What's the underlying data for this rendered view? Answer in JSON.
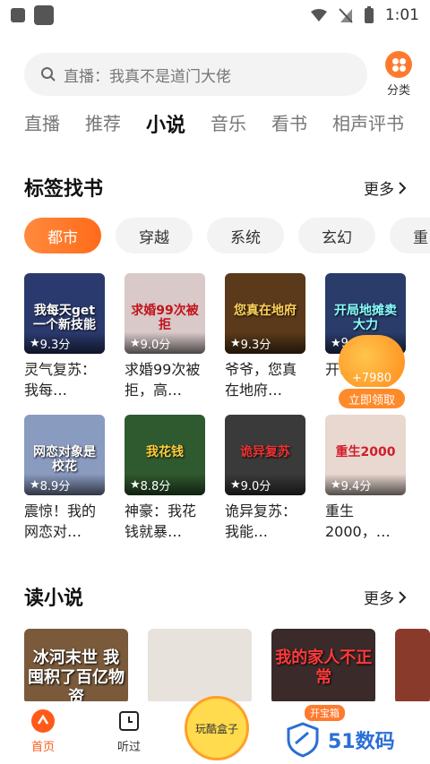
{
  "status": {
    "time": "1:01"
  },
  "search": {
    "placeholder_text": "直播：我真不是道门大佬",
    "category_label": "分类"
  },
  "tabs": [
    "直播",
    "推荐",
    "小说",
    "音乐",
    "看书",
    "相声评书"
  ],
  "section1": {
    "title": "标签找书",
    "more": "更多"
  },
  "chips": [
    "都市",
    "穿越",
    "系统",
    "玄幻",
    "重"
  ],
  "books_row1": [
    {
      "cover": "我每天get一个新技能",
      "rating": "9.3分",
      "name": "灵气复苏：我每…",
      "color": "#2b3a6e"
    },
    {
      "cover": "求婚99次被拒",
      "rating": "9.0分",
      "name": "求婚99次被拒，高…",
      "color": "#d9c9c9"
    },
    {
      "cover": "您真在地府",
      "rating": "9.3分",
      "name": "爷爷，您真在地府…",
      "color": "#5a3a1a"
    },
    {
      "cover": "开局地摊卖大力",
      "rating": "9",
      "name": "开…卖…",
      "color": "#2a3c6a"
    }
  ],
  "books_row2": [
    {
      "cover": "网恋对象是校花",
      "rating": "8.9分",
      "name": "震惊！我的网恋对…",
      "color": "#8a9bc0"
    },
    {
      "cover": "我花钱",
      "rating": "8.8分",
      "name": "神豪：我花钱就暴…",
      "color": "#2f5a2f"
    },
    {
      "cover": "诡异复苏",
      "rating": "9.0分",
      "name": "诡异复苏：我能…",
      "color": "#3a3a3a"
    },
    {
      "cover": "重生2000",
      "rating": "9.4分",
      "name": "重生2000，…",
      "color": "#e8d8d0"
    }
  ],
  "reward": {
    "amount": "+7980",
    "button": "立即领取"
  },
  "section2": {
    "title": "读小说",
    "more": "更多"
  },
  "books_row3": [
    {
      "cover": "冰河末世 我囤积了百亿物资",
      "color": "#7a5a3a"
    },
    {
      "cover": "",
      "color": "#e8e2dc"
    },
    {
      "cover": "我的家人不正常",
      "color": "#3a2a2a"
    },
    {
      "cover": "",
      "color": "#8a3a2a"
    }
  ],
  "nav": {
    "home": "首页",
    "listened": "听过",
    "center": "玩酷盒子",
    "badge": "开宝箱"
  },
  "watermark": "51数码",
  "colors": {
    "accent": "#ff6b1a"
  }
}
